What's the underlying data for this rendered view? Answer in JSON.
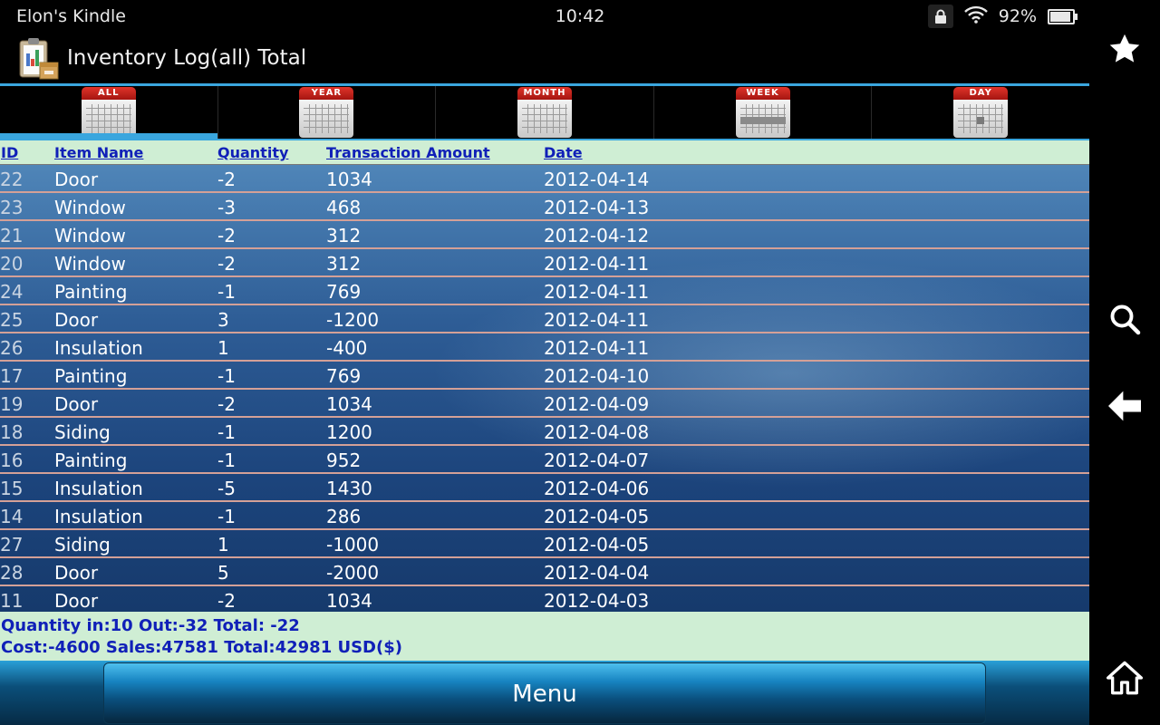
{
  "status": {
    "device": "Elon's Kindle",
    "time": "10:42",
    "battery": "92%",
    "battery_level": 0.92
  },
  "app": {
    "title": "Inventory Log(all) Total"
  },
  "tabs": [
    {
      "label": "ALL",
      "active": true
    },
    {
      "label": "YEAR",
      "active": false
    },
    {
      "label": "MONTH",
      "active": false
    },
    {
      "label": "WEEK",
      "active": false
    },
    {
      "label": "DAY",
      "active": false
    }
  ],
  "table": {
    "headers": {
      "id": "ID",
      "name": "Item Name",
      "qty": "Quantity",
      "amount": "Transaction Amount",
      "date": "Date"
    },
    "rows": [
      {
        "id": "22",
        "name": "Door",
        "qty": "-2",
        "amount": "1034",
        "date": "2012-04-14"
      },
      {
        "id": "23",
        "name": "Window",
        "qty": "-3",
        "amount": "468",
        "date": "2012-04-13"
      },
      {
        "id": "21",
        "name": "Window",
        "qty": "-2",
        "amount": "312",
        "date": "2012-04-12"
      },
      {
        "id": "20",
        "name": "Window",
        "qty": "-2",
        "amount": "312",
        "date": "2012-04-11"
      },
      {
        "id": "24",
        "name": "Painting",
        "qty": "-1",
        "amount": "769",
        "date": "2012-04-11"
      },
      {
        "id": "25",
        "name": "Door",
        "qty": "3",
        "amount": "-1200",
        "date": "2012-04-11"
      },
      {
        "id": "26",
        "name": "Insulation",
        "qty": "1",
        "amount": "-400",
        "date": "2012-04-11"
      },
      {
        "id": "17",
        "name": "Painting",
        "qty": "-1",
        "amount": "769",
        "date": "2012-04-10"
      },
      {
        "id": "19",
        "name": "Door",
        "qty": "-2",
        "amount": "1034",
        "date": "2012-04-09"
      },
      {
        "id": "18",
        "name": "Siding",
        "qty": "-1",
        "amount": "1200",
        "date": "2012-04-08"
      },
      {
        "id": "16",
        "name": "Painting",
        "qty": "-1",
        "amount": "952",
        "date": "2012-04-07"
      },
      {
        "id": "15",
        "name": "Insulation",
        "qty": "-5",
        "amount": "1430",
        "date": "2012-04-06"
      },
      {
        "id": "14",
        "name": "Insulation",
        "qty": "-1",
        "amount": "286",
        "date": "2012-04-05"
      },
      {
        "id": "27",
        "name": "Siding",
        "qty": "1",
        "amount": "-1000",
        "date": "2012-04-05"
      },
      {
        "id": "28",
        "name": "Door",
        "qty": "5",
        "amount": "-2000",
        "date": "2012-04-04"
      },
      {
        "id": "11",
        "name": "Door",
        "qty": "-2",
        "amount": "1034",
        "date": "2012-04-03"
      }
    ]
  },
  "summary": {
    "line1": "Quantity in:10 Out:-32 Total: -22",
    "line2": "Cost:-4600 Sales:47581 Total:42981 USD($)"
  },
  "menu": {
    "label": "Menu"
  },
  "nav_icons": [
    "star-icon",
    "search-icon",
    "back-arrow-icon",
    "home-icon"
  ],
  "colors": {
    "accent": "#3aa6de",
    "header_bg": "#cfeed4",
    "header_text": "#1020b8",
    "row_divider": "#d4a097"
  }
}
